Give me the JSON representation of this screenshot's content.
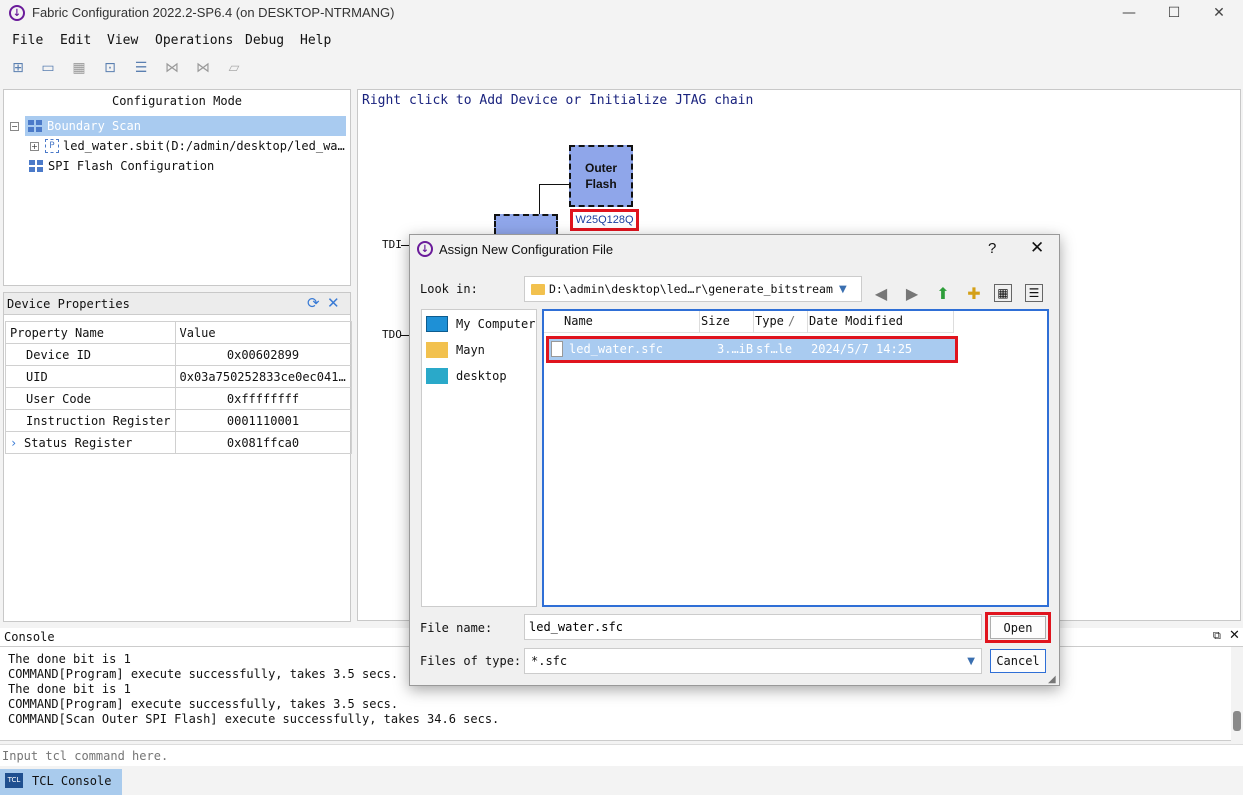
{
  "window": {
    "title": "Fabric Configuration 2022.2-SP6.4 (on DESKTOP-NTRMANG)",
    "icon": "download-circle-icon"
  },
  "menu": [
    "File",
    "Edit",
    "View",
    "Operations",
    "Debug",
    "Help"
  ],
  "toolbar": {
    "icons": [
      "boundary-scan-icon",
      "display-icon",
      "grid-icon",
      "chip-icon",
      "list-icon",
      "chain-icon",
      "chain2-icon",
      "memory-icon"
    ]
  },
  "config_panel": {
    "header": "Configuration Mode",
    "tree": [
      {
        "label": "Boundary Scan",
        "selected": true
      },
      {
        "label": "led_water.sbit(D:/admin/desktop/led_wa…"
      },
      {
        "label": "SPI Flash Configuration"
      }
    ]
  },
  "device_properties": {
    "title": "Device Properties",
    "columns": [
      "Property Name",
      "Value"
    ],
    "rows": [
      {
        "name": "Device ID",
        "value": "0x00602899"
      },
      {
        "name": "UID",
        "value": "0x03a750252833ce0ec0411…"
      },
      {
        "name": "User Code",
        "value": "0xffffffff"
      },
      {
        "name": "Instruction Register",
        "value": "0001110001"
      },
      {
        "name": "Status Register",
        "value": "0x081ffca0",
        "expander": "›"
      }
    ]
  },
  "canvas": {
    "hint": "Right click to Add Device or Initialize JTAG chain",
    "outer_flash": "Outer\nFlash",
    "flash_part": "W25Q128Q",
    "tdi": "TDI",
    "tdo": "TDO"
  },
  "console": {
    "title": "Console",
    "lines": [
      "The done bit is 1",
      "COMMAND[Program] execute successfully, takes 3.5 secs.",
      "The done bit is 1",
      "COMMAND[Program] execute successfully, takes 3.5 secs.",
      "COMMAND[Scan Outer SPI Flash] execute successfully, takes 34.6 secs."
    ],
    "input_placeholder": "Input tcl command here.",
    "tab_label": "TCL Console",
    "tab_icon_text": "TCL"
  },
  "dialog": {
    "title": "Assign New Configuration File",
    "help": "?",
    "look_in_label": "Look in:",
    "look_in_path": "D:\\admin\\desktop\\led…r\\generate_bitstream",
    "places": [
      "My Computer",
      "Mayn",
      "desktop"
    ],
    "columns": [
      "Name",
      "Size",
      "Type",
      "Date Modified"
    ],
    "sort_mark": "/",
    "files": [
      {
        "name": "led_water.sfc",
        "size": "3.…iB",
        "type": "sf…le",
        "date": "2024/5/7 14:25"
      }
    ],
    "file_name_label": "File name:",
    "file_name_value": "led_water.sfc",
    "file_type_label": "Files of type:",
    "file_type_value": "*.sfc",
    "open_label": "Open",
    "cancel_label": "Cancel"
  },
  "colors": {
    "accent": "#a9cbf0",
    "highlight": "#e0141e",
    "chip": "#8fa6ea"
  }
}
